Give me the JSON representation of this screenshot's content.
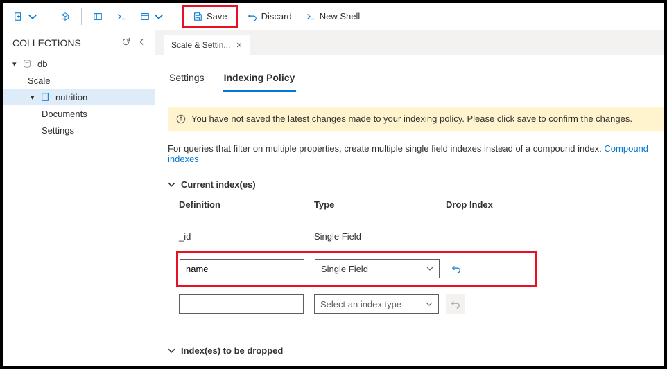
{
  "toolbar": {
    "save_label": "Save",
    "discard_label": "Discard",
    "newshell_label": "New Shell"
  },
  "sidebar": {
    "title": "COLLECTIONS",
    "tree": {
      "db_label": "db",
      "scale_label": "Scale",
      "nutrition_label": "nutrition",
      "documents_label": "Documents",
      "settings_label": "Settings"
    }
  },
  "tab": {
    "label": "Scale & Settin..."
  },
  "subtabs": {
    "settings": "Settings",
    "indexing": "Indexing Policy"
  },
  "warning": "You have not saved the latest changes made to your indexing policy. Please click save to confirm the changes.",
  "description": {
    "text": "For queries that filter on multiple properties, create multiple single field indexes instead of a compound index. ",
    "link": "Compound indexes"
  },
  "sections": {
    "current": "Current index(es)",
    "dropped": "Index(es) to be dropped"
  },
  "idx_table": {
    "headers": {
      "definition": "Definition",
      "type": "Type",
      "drop": "Drop Index"
    },
    "rows": [
      {
        "definition": "_id",
        "type": "Single Field",
        "editable": false
      },
      {
        "definition": "name",
        "type": "Single Field",
        "editable": true,
        "highlighted": true
      },
      {
        "definition": "",
        "type_placeholder": "Select an index type",
        "editable": true,
        "disabled_undo": true
      }
    ]
  }
}
